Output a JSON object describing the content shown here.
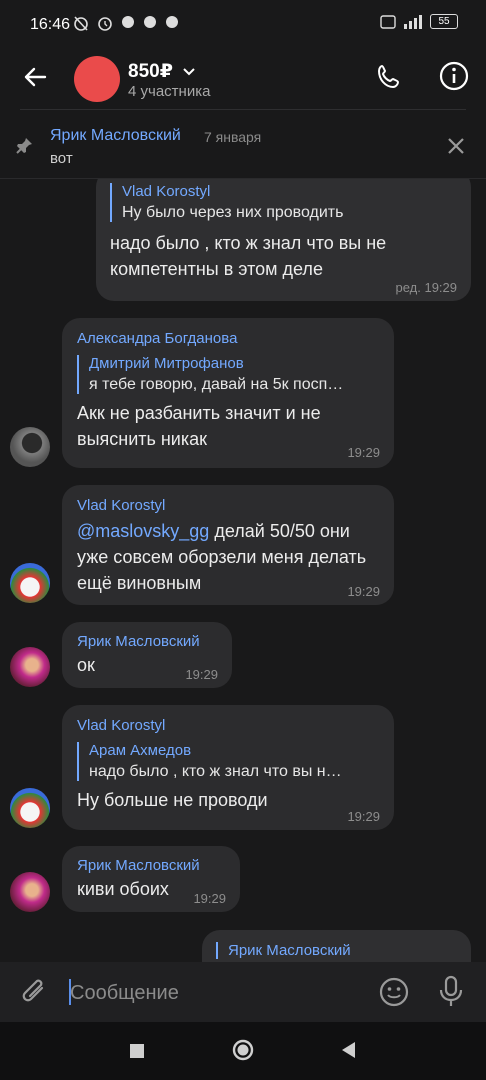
{
  "status_bar": {
    "time": "16:46",
    "battery": "55"
  },
  "header": {
    "title": "850₽",
    "subtitle": "4 участника"
  },
  "pinned": {
    "name": "Ярик Масловский",
    "date": "7 января",
    "text": "вот"
  },
  "messages": [
    {
      "direction": "out",
      "quote_author": "Vlad Korostyl",
      "quote_text": "Ну было через них проводить",
      "text": "надо было , кто ж знал что вы не компетентны в этом деле",
      "time": "ред. 19:29"
    },
    {
      "direction": "in",
      "sender": "Александра Богданова",
      "quote_author": "Дмитрий Митрофанов",
      "quote_text": "я тебе говорю, давай на 5к посп…",
      "text": "Акк не разбанить значит и не выяснить никак",
      "time": "19:29"
    },
    {
      "direction": "in",
      "sender": "Vlad Korostyl",
      "mention": "@maslovsky_gg",
      "text": " делай 50/50 они уже совсем оборзели меня делать ещё виновным",
      "time": "19:29"
    },
    {
      "direction": "in",
      "sender": "Ярик Масловский",
      "text": "ок",
      "time": "19:29"
    },
    {
      "direction": "in",
      "sender": "Vlad Korostyl",
      "quote_author": "Арам Ахмедов",
      "quote_text": "надо было , кто ж знал что вы н…",
      "text": "Ну больше не проводи",
      "time": "19:29"
    },
    {
      "direction": "in",
      "sender": "Ярик Масловский",
      "text": "киви обоих",
      "time": "19:29"
    },
    {
      "direction": "out",
      "quote_author": "Ярик Масловский"
    }
  ],
  "input": {
    "placeholder": "Сообщение"
  },
  "colors": {
    "accent": "#73a9ff",
    "background": "#19191a",
    "bubble": "#2c2c2e",
    "group_avatar": "#ea4b4b"
  }
}
